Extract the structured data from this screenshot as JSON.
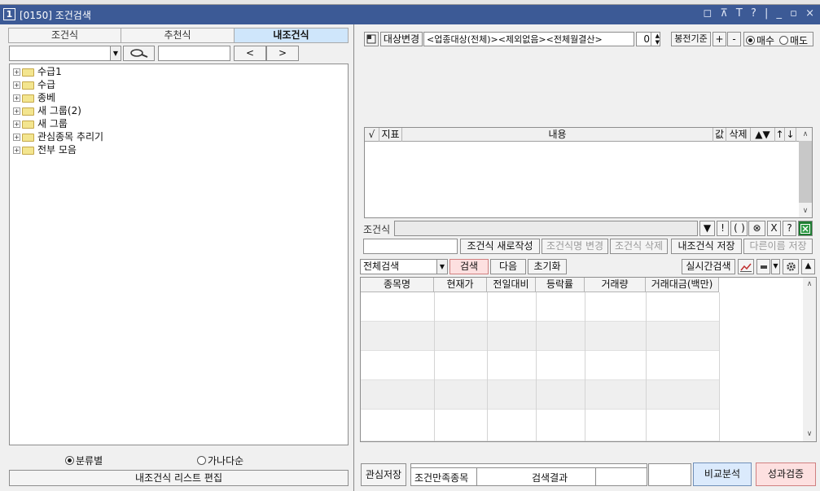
{
  "window": {
    "number": "1",
    "title": "[0150] 조건검색",
    "controls": "◻ ⊼ T ? | _ ▫ ×"
  },
  "tabs": [
    {
      "label": "조건식"
    },
    {
      "label": "추천식"
    },
    {
      "label": "내조건식"
    }
  ],
  "left_toolbar": {
    "combo_value": "",
    "search_value": "",
    "prev": "<",
    "next": ">"
  },
  "tree": [
    {
      "label": "수급1"
    },
    {
      "label": "수급"
    },
    {
      "label": "종베"
    },
    {
      "label": "새 그룹(2)"
    },
    {
      "label": "새 그룹"
    },
    {
      "label": "관심종목 추리기"
    },
    {
      "label": "전부 모음"
    }
  ],
  "sort": {
    "by_category": "분류별",
    "by_alpha": "가나다순",
    "selected": "by_category"
  },
  "edit_list_button": "내조건식 리스트 편집",
  "target": {
    "change_button": "대상변경",
    "description": "<업종대상(전체)><제외없음><전체월결산>",
    "spin_value": "0",
    "bong_basis": "봉전기준",
    "plus": "+",
    "minus": "-",
    "buy": "매수",
    "sell": "매도",
    "selected": "buy"
  },
  "cond_columns": {
    "check": "√",
    "indicator": "지표",
    "content": "내용",
    "value": "값",
    "delete": "삭제",
    "updown": "▲▼",
    "up": "↑",
    "down": "↓"
  },
  "formula": {
    "label": "조건식",
    "value": "",
    "ops": [
      "▼",
      "!",
      "(",
      ")",
      "⊗",
      "X",
      "?"
    ]
  },
  "cond_actions": {
    "name_value": "",
    "new": "조건식 새로작성",
    "rename": "조건식명 변경",
    "delete": "조건식 삭제",
    "save": "내조건식 저장",
    "save_as": "다른이름 저장"
  },
  "search_bar": {
    "scope": "전체검색",
    "search": "검색",
    "next": "다음",
    "reset": "초기화",
    "realtime": "실시간검색"
  },
  "result_columns": [
    "종목명",
    "현재가",
    "전일대비",
    "등락률",
    "거래량",
    "거래대금(백만)"
  ],
  "bottom": {
    "save_interest": "관심저장",
    "cond_stocks": "조건만족종목",
    "search_result": "검색결과",
    "compare": "비교분석",
    "performance": "성과검증"
  },
  "colors": {
    "titlebar": "#3c5a96",
    "tab_active": "#cfe6fb",
    "search_btn": "#fde0e0",
    "compare_btn": "#dbeafc",
    "perf_btn": "#fde0e0",
    "excel": "#1e7d32"
  }
}
